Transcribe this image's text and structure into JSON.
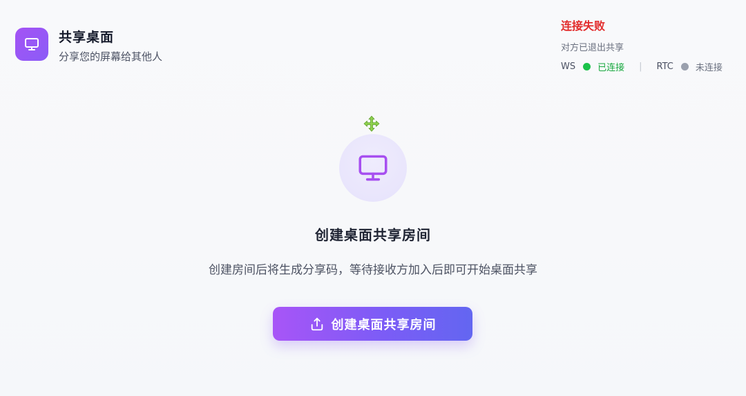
{
  "header": {
    "app_icon": "monitor-icon",
    "title": "共享桌面",
    "subtitle": "分享您的屏幕给其他人"
  },
  "status": {
    "title": "连接失败",
    "detail": "对方已退出共享",
    "ws": {
      "label": "WS",
      "state": "已连接",
      "color": "#1bc24a"
    },
    "separator": "|",
    "rtc": {
      "label": "RTC",
      "state": "未连接",
      "color": "#9aa0ad"
    }
  },
  "main": {
    "move_icon": "move-arrows-icon",
    "hero_icon": "monitor-icon",
    "title": "创建桌面共享房间",
    "description": "创建房间后将生成分享码，等待接收方加入后即可开始桌面共享",
    "create_button": {
      "label": "创建桌面共享房间",
      "icon": "share-upload-icon"
    }
  },
  "colors": {
    "accent": "#8b5cf6",
    "error": "#e22a2a",
    "success": "#17a83e"
  }
}
